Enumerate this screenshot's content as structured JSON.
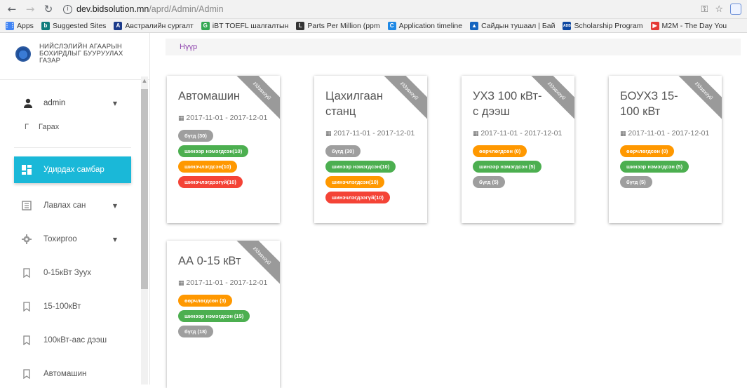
{
  "browser": {
    "url_host": "dev.bidsolution.mn",
    "url_path": "/aprd/Admin/Admin",
    "bookmarks": [
      {
        "label": "Apps",
        "icon": "apps-grid-icon",
        "color": "#4285f4"
      },
      {
        "label": "Suggested Sites",
        "icon": "bing-icon",
        "color": "#0f7c7c"
      },
      {
        "label": "Австралийн сургалт",
        "icon": "australia-icon",
        "color": "#1b3a8a"
      },
      {
        "label": "iBT TOEFL шалгалтын",
        "icon": "google-icon",
        "color": "#34a853"
      },
      {
        "label": "Parts Per Million (ppm",
        "icon": "l-icon",
        "color": "#333333"
      },
      {
        "label": "Application timeline",
        "icon": "c-icon",
        "color": "#1e88e5"
      },
      {
        "label": "Сайдын тушаал | Бай",
        "icon": "government-icon",
        "color": "#1565c0"
      },
      {
        "label": "Scholarship Program",
        "icon": "adb-icon",
        "color": "#0d47a1"
      },
      {
        "label": "M2M - The Day You",
        "icon": "youtube-icon",
        "color": "#e53935"
      }
    ]
  },
  "sidebar": {
    "brand": [
      "НИЙСЛЭЛИЙН АГААРЫН",
      "БОХИРДЛЫГ БУУРУУЛАХ",
      "ГАЗАР"
    ],
    "user": "admin",
    "logout_prefix": "Г",
    "logout": "Гарах",
    "active_item": "Удирдах самбар",
    "items": [
      {
        "label": "Лавлах сан",
        "icon": "book-icon",
        "has_caret": true
      },
      {
        "label": "Тохиргоо",
        "icon": "gear-icon",
        "has_caret": true
      },
      {
        "label": "0-15кВт Зуух",
        "icon": "bookmark-icon",
        "has_caret": false
      },
      {
        "label": "15-100кВт",
        "icon": "bookmark-icon",
        "has_caret": false
      },
      {
        "label": "100кВт-аас дээш",
        "icon": "bookmark-icon",
        "has_caret": false
      },
      {
        "label": "Автомашин",
        "icon": "bookmark-icon",
        "has_caret": false
      }
    ]
  },
  "breadcrumb": "Нүүр",
  "ribbon_label": "Идэвхгүй",
  "cards": [
    {
      "title": "Автомашин",
      "date": "2017-11-01 - 2017-12-01",
      "badges": [
        {
          "text": "бүгд (30)",
          "color": "gray"
        },
        {
          "text": "шинээр нэмэгдсэн(10)",
          "color": "green"
        },
        {
          "text": "шинэчлэгдсэн(10)",
          "color": "orange"
        },
        {
          "text": "шинэчлэгдээгүй(10)",
          "color": "red"
        }
      ]
    },
    {
      "title": "Цахилгаан станц",
      "date": "2017-11-01 - 2017-12-01",
      "badges": [
        {
          "text": "бүгд (30)",
          "color": "gray"
        },
        {
          "text": "шинээр нэмэгдсэн(10)",
          "color": "green"
        },
        {
          "text": "шинэчлэгдсэн(10)",
          "color": "orange"
        },
        {
          "text": "шинэчлэгдээгүй(10)",
          "color": "red"
        }
      ]
    },
    {
      "title": "УХЗ 100 кВт-с дээш",
      "date": "2017-11-01 - 2017-12-01",
      "badges": [
        {
          "text": "өөрчлөгдсөн (0)",
          "color": "orange"
        },
        {
          "text": "шинээр нэмэгдсэн (5)",
          "color": "green"
        },
        {
          "text": "бүгд (5)",
          "color": "gray"
        }
      ]
    },
    {
      "title": "БОУХЗ 15-100 кВт",
      "date": "2017-11-01 - 2017-12-01",
      "badges": [
        {
          "text": "өөрчлөгдсөн (0)",
          "color": "orange"
        },
        {
          "text": "шинээр нэмэгдсэн (5)",
          "color": "green"
        },
        {
          "text": "бүгд (5)",
          "color": "gray"
        }
      ]
    },
    {
      "title": "АА 0-15 кВт",
      "date": "2017-11-01 - 2017-12-01",
      "badges": [
        {
          "text": "өөрчлөгдсөн (3)",
          "color": "orange"
        },
        {
          "text": "шинээр нэмэгдсэн (15)",
          "color": "green"
        },
        {
          "text": "бүгд (18)",
          "color": "gray"
        }
      ]
    }
  ],
  "colors": {
    "accent": "#1ab8d8",
    "badge_gray": "#9e9e9e",
    "badge_green": "#4caf50",
    "badge_orange": "#ff9800",
    "badge_red": "#f44336"
  }
}
